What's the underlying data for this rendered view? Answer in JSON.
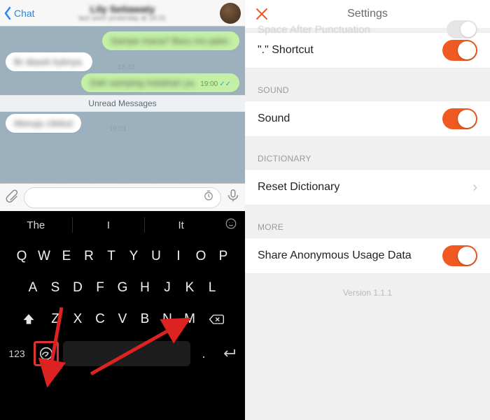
{
  "left": {
    "back_label": "Chat",
    "contact_name": "Lily Setiawaty",
    "contact_sub": "last seen yesterday at 18:31",
    "messages": {
      "m1_text": "Sampe mana? Baru mo jalan.",
      "m1_time": "",
      "m2_text": "Br depok kyknya.",
      "m2_time": "18:43",
      "m3_text": "Dah samping matahari ya.",
      "m3_time": "19:00",
      "m4_text": "Menuju cilebut",
      "m4_time": "19:01"
    },
    "unread_label": "Unread Messages",
    "suggestions": {
      "s1": "The",
      "s2": "I",
      "s3": "It"
    },
    "keys": {
      "r1": [
        "Q",
        "W",
        "E",
        "R",
        "T",
        "Y",
        "U",
        "I",
        "O",
        "P"
      ],
      "r2": [
        "A",
        "S",
        "D",
        "F",
        "G",
        "H",
        "J",
        "K",
        "L"
      ],
      "r3": [
        "Z",
        "X",
        "C",
        "V",
        "B",
        "N",
        "M"
      ]
    },
    "key_123": "123",
    "dot_key": "."
  },
  "right": {
    "title": "Settings",
    "ghost_label": "Space After Punctuation",
    "shortcut_label": "\".\" Shortcut",
    "section_sound": "SOUND",
    "sound_label": "Sound",
    "section_dict": "DICTIONARY",
    "reset_label": "Reset Dictionary",
    "section_more": "MORE",
    "share_label": "Share Anonymous Usage Data",
    "version": "Version 1.1.1"
  }
}
